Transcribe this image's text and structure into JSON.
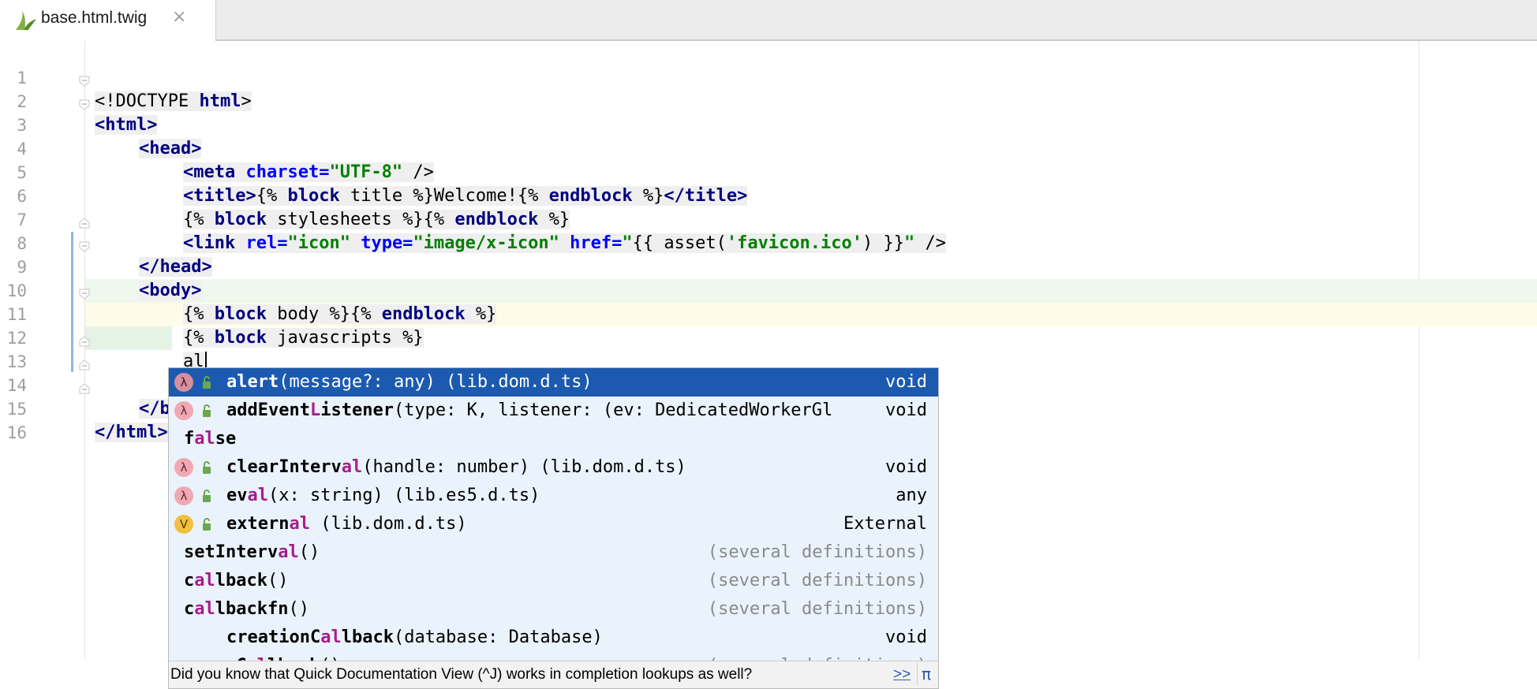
{
  "tab": {
    "title": "base.html.twig",
    "close_icon": "close-icon",
    "file_icon": "twig-file-icon"
  },
  "editor": {
    "line_numbers": [
      "1",
      "2",
      "3",
      "4",
      "5",
      "6",
      "7",
      "8",
      "9",
      "10",
      "11",
      "12",
      "13",
      "14",
      "15",
      "16"
    ],
    "lines": {
      "l1": [
        "<!DOCTYPE ",
        "html",
        ">"
      ],
      "l2": [
        "<html>"
      ],
      "l3": [
        "<head>"
      ],
      "l4": [
        "<meta ",
        "charset=",
        "\"UTF-8\"",
        " />"
      ],
      "l5": [
        "<title>",
        "{% ",
        "block",
        " title %}",
        "Welcome!",
        "{% ",
        "endblock",
        " %}",
        "</title>"
      ],
      "l6": [
        "{% ",
        "block",
        " stylesheets %}",
        "{% ",
        "endblock",
        " %}"
      ],
      "l7": [
        "<link ",
        "rel=",
        "\"icon\"",
        " ",
        "type=",
        "\"image/x-icon\"",
        " ",
        "href=",
        "\"",
        "{{ asset(",
        "'favicon.ico'",
        ") }}",
        "\"",
        " />"
      ],
      "l8": [
        "</head>"
      ],
      "l9": [
        "<body>"
      ],
      "l10": [
        "{% ",
        "block",
        " body %}",
        "{% ",
        "endblock",
        " %}"
      ],
      "l11": [
        "{% ",
        "block",
        " javascripts %}"
      ],
      "l12": [
        "al"
      ],
      "l14": [
        "</b"
      ],
      "l15": [
        "</html>"
      ]
    }
  },
  "completion": {
    "items": [
      {
        "kind": "lambda",
        "icon": "lambda-icon",
        "prefix": "",
        "hl": "al",
        "rest": "ert",
        "sig": "(message?: any) (lib.dom.d.ts)",
        "type": "void",
        "selected": true
      },
      {
        "kind": "lambda",
        "icon": "lambda-icon",
        "prefix": "addEvent",
        "hl": "L",
        "rest": "istener",
        "sig": "(type: K, listener: (ev: DedicatedWorkerGl",
        "type": "void"
      },
      {
        "kind": "none",
        "prefix": "f",
        "hl": "al",
        "rest": "se",
        "sig": "",
        "type": ""
      },
      {
        "kind": "lambda",
        "icon": "lambda-icon",
        "prefix": "clearInterv",
        "hl": "al",
        "rest": "",
        "sig": "(handle: number) (lib.dom.d.ts)",
        "type": "void"
      },
      {
        "kind": "lambda",
        "icon": "lambda-icon",
        "prefix": "ev",
        "hl": "al",
        "rest": "",
        "sig": "(x: string) (lib.es5.d.ts)",
        "type": "any"
      },
      {
        "kind": "v",
        "icon": "variable-icon",
        "prefix": "extern",
        "hl": "al",
        "rest": "",
        "sig": " (lib.dom.d.ts)",
        "type": "External"
      },
      {
        "kind": "none",
        "prefix": "setInterv",
        "hl": "al",
        "rest": "",
        "sig": "()",
        "type": "(several definitions)",
        "gray": true
      },
      {
        "kind": "none",
        "prefix": "c",
        "hl": "al",
        "rest": "lback",
        "sig": "()",
        "type": "(several definitions)",
        "gray": true
      },
      {
        "kind": "none",
        "prefix": "c",
        "hl": "al",
        "rest": "lbackfn",
        "sig": "()",
        "type": "(several definitions)",
        "gray": true
      },
      {
        "kind": "indent",
        "prefix": "creationC",
        "hl": "al",
        "rest": "lback",
        "sig": "(database: Database)",
        "type": "void"
      },
      {
        "kind": "none",
        "prefix": "errorC",
        "hl": "al",
        "rest": "lback",
        "sig": "()",
        "type": "(several definitions)",
        "gray": true
      }
    ],
    "hint": "Did you know that Quick Documentation View (^J) works in completion lookups as well?",
    "hint_link": ">>",
    "hint_pi": "π",
    "colors": {
      "selection": "#1c5aaf",
      "match_highlight": "#a71d8c",
      "popup_bg": "#eaf3fb"
    }
  }
}
